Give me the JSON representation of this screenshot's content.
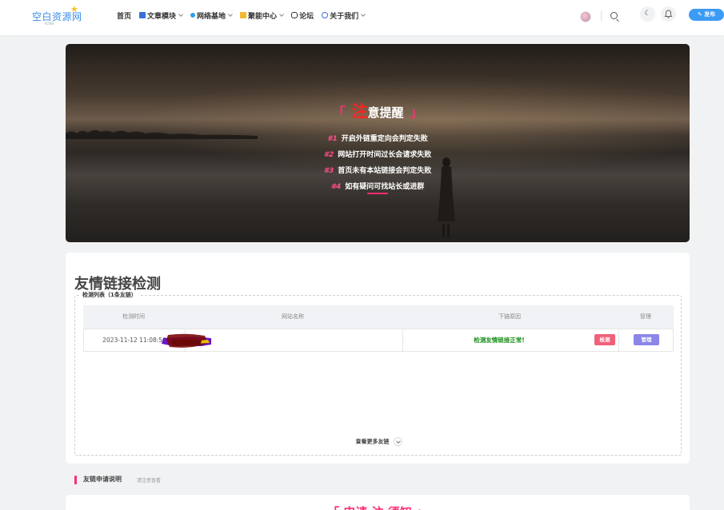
{
  "header": {
    "logo_text": "空白资源网",
    "logo_sub": "KONB",
    "nav": [
      {
        "label": "首页",
        "icon": "",
        "has_dropdown": false
      },
      {
        "label": "文章模块",
        "icon": "book-icon",
        "has_dropdown": true
      },
      {
        "label": "网络基地",
        "icon": "globe-icon",
        "has_dropdown": true
      },
      {
        "label": "聚能中心",
        "icon": "grid-icon",
        "has_dropdown": true
      },
      {
        "label": "论坛",
        "icon": "chat-icon",
        "has_dropdown": false
      },
      {
        "label": "关于我们",
        "icon": "info-icon",
        "has_dropdown": true
      }
    ],
    "publish_label": "✎ 发布"
  },
  "banner": {
    "title_left_bracket": "「",
    "title_highlight": "注",
    "title_rest": "意提醒",
    "title_right_bracket": "」",
    "items": [
      {
        "num": "#1",
        "text": "开启外链重定向会判定失败"
      },
      {
        "num": "#2",
        "text": "网站打开时间过长会请求失败"
      },
      {
        "num": "#3",
        "text": "首页未有本站链接会判定失败"
      },
      {
        "num": "#4",
        "text": "如有疑问可找站长或进群"
      }
    ]
  },
  "checker": {
    "title": "友情链接检测",
    "list_label": "检测列表（1条友链）",
    "columns": [
      "检测时间",
      "网站名称",
      "下链原因",
      "管理"
    ],
    "rows": [
      {
        "time": "2023-11-12 11:08:56",
        "site": "",
        "reason": "检测友情链接正常!",
        "detect_label": "检测",
        "manage_label": "管理"
      }
    ],
    "more_label": "查看更多友链"
  },
  "apply_section": {
    "title": "友链申请说明",
    "subtitle": "请注意查看",
    "fragment": "「 申请 注 须知 」"
  },
  "colors": {
    "accent_pink": "#ff2d73",
    "ok_green": "#1a8e1a",
    "publish_blue": "#3b9bf5",
    "detect_red": "#f0607a",
    "manage_purple": "#8b86e8"
  }
}
